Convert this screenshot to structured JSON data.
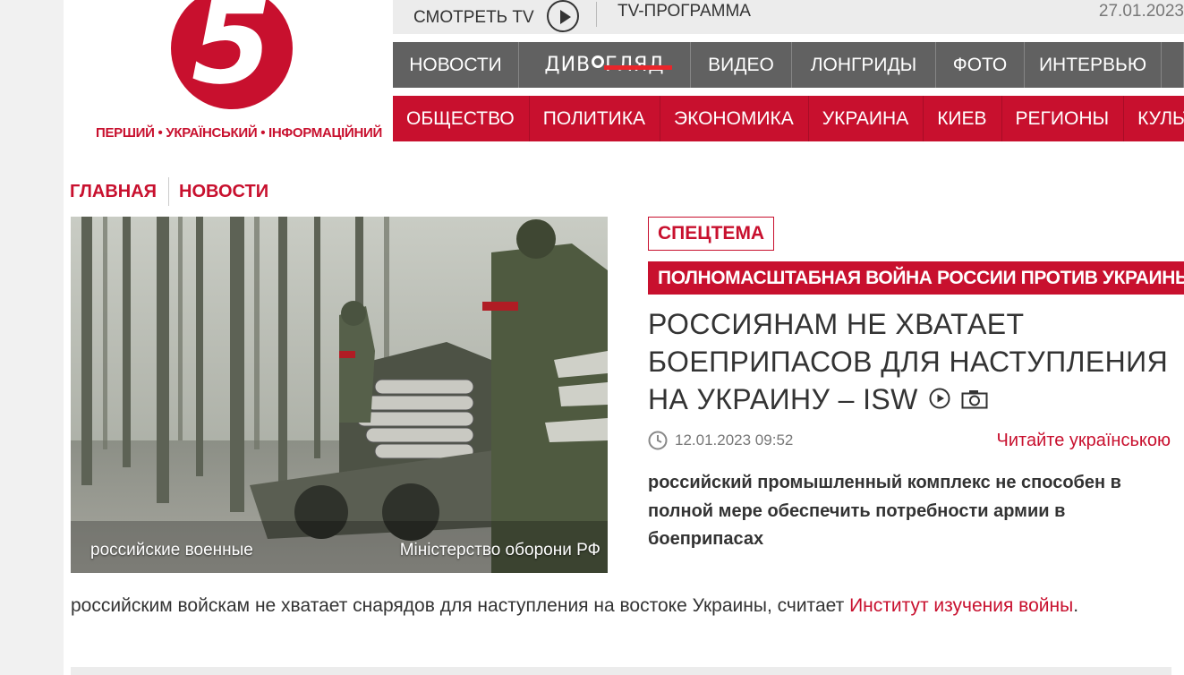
{
  "brand": {
    "logo_number": "5",
    "tagline": "ПЕРШИЙ • УКРАЇНСЬКИЙ • ІНФОРМАЦІЙНИЙ"
  },
  "topbar": {
    "watch_tv": "СМОТРЕТЬ TV",
    "tv_program": "TV-ПРОГРАММА",
    "date": "27.01.2023"
  },
  "nav_primary": {
    "items": [
      "НОВОСТИ",
      "ДИВОГЛЯД",
      "ВИДЕО",
      "ЛОНГРИДЫ",
      "ФОТО",
      "ИНТЕРВЬЮ"
    ],
    "divo_left": "ДИВ",
    "divo_right": "ГЛЯД"
  },
  "nav_sections": {
    "items": [
      "ОБЩЕСТВО",
      "ПОЛИТИКА",
      "ЭКОНОМИКА",
      "УКРАИНА",
      "КИЕВ",
      "РЕГИОНЫ",
      "КУЛЬТУРА"
    ]
  },
  "breadcrumbs": [
    "ГЛАВНАЯ",
    "НОВОСТИ"
  ],
  "article": {
    "special_tag": "СПЕЦТЕМА",
    "topic_tag": "ПОЛНОМАСШТАБНАЯ ВОЙНА РОССИИ ПРОТИВ УКРАИНЫ",
    "headline": "РОССИЯНАМ НЕ ХВАТАЕТ БОЕПРИПАСОВ ДЛЯ НАСТУПЛЕНИЯ НА УКРАИНУ – ISW",
    "published": "12.01.2023 09:52",
    "read_ukrainian": "Читайте українською",
    "lead": "российский промышленный комплекс не способен в полной мере обеспечить потребности армии в боеприпасах",
    "photo_caption": "российские военные",
    "photo_credit": "Міністерство оборони РФ",
    "body_start": "российским войскам не хватает снарядов для наступления на востоке Украины, считает ",
    "body_link": "Институт изучения войны",
    "body_end": "."
  },
  "colors": {
    "brand_red": "#c8102e",
    "nav_grey": "#616161",
    "divo_accent": "#e8262b"
  },
  "icons": [
    "play-icon",
    "camera-icon",
    "clock-icon"
  ]
}
